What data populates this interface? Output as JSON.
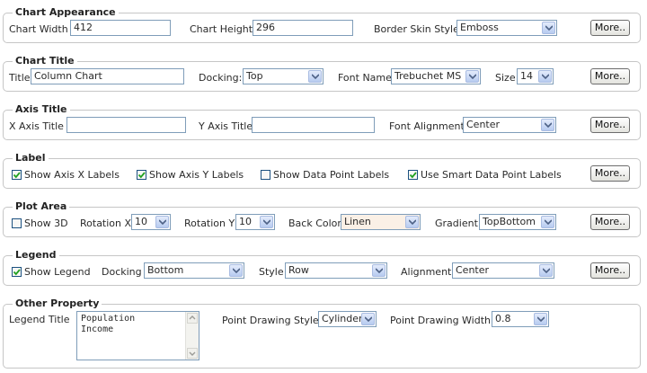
{
  "chart_appearance": {
    "legend": "Chart Appearance",
    "chart_width_label": "Chart Width",
    "chart_width_value": "412",
    "chart_height_label": "Chart Height",
    "chart_height_value": "296",
    "border_skin_label": "Border Skin Style",
    "border_skin_value": "Emboss",
    "more_label": "More.."
  },
  "chart_title": {
    "legend": "Chart Title",
    "title_label": "Title",
    "title_value": "Column Chart",
    "docking_label": "Docking:",
    "docking_value": "Top",
    "font_name_label": "Font Name",
    "font_name_value": "Trebuchet MS",
    "size_label": "Size",
    "size_value": "14",
    "more_label": "More.."
  },
  "axis_title": {
    "legend": "Axis Title",
    "x_label": "X Axis Title",
    "x_value": "",
    "y_label": "Y Axis Title",
    "y_value": "",
    "font_alignment_label": "Font Alignment",
    "font_alignment_value": "Center",
    "more_label": "More.."
  },
  "label": {
    "legend": "Label",
    "show_axis_x": {
      "label": "Show Axis X Labels",
      "checked": true
    },
    "show_axis_y": {
      "label": "Show Axis Y Labels",
      "checked": true
    },
    "show_data_point": {
      "label": "Show Data Point Labels",
      "checked": false
    },
    "smart_labels": {
      "label": "Use Smart Data Point Labels",
      "checked": true
    },
    "more_label": "More.."
  },
  "plot_area": {
    "legend": "Plot Area",
    "show_3d": {
      "label": "Show 3D",
      "checked": false
    },
    "rotation_x_label": "Rotation X",
    "rotation_x_value": "10",
    "rotation_y_label": "Rotation Y",
    "rotation_y_value": "10",
    "back_color_label": "Back Color",
    "back_color_value": "Linen",
    "back_color_hex": "#faf0e6",
    "gradient_label": "Gradient",
    "gradient_value": "TopBottom",
    "more_label": "More.."
  },
  "legend_section": {
    "legend": "Legend",
    "show_legend": {
      "label": "Show Legend",
      "checked": true
    },
    "docking_label": "Docking",
    "docking_value": "Bottom",
    "style_label": "Style",
    "style_value": "Row",
    "alignment_label": "Alignment",
    "alignment_value": "Center",
    "more_label": "More.."
  },
  "other_property": {
    "legend": "Other Property",
    "legend_title_label": "Legend Title",
    "legend_title_lines": [
      "Population",
      "Income"
    ],
    "point_style_label": "Point Drawing Style",
    "point_style_value": "Cylinder",
    "point_width_label": "Point Drawing Width",
    "point_width_value": "0.8"
  },
  "colors": {
    "border": "#c6c6c6",
    "input_border": "#7f9db9",
    "checkbox_border": "#1c5180",
    "check_mark": "#21a121"
  }
}
